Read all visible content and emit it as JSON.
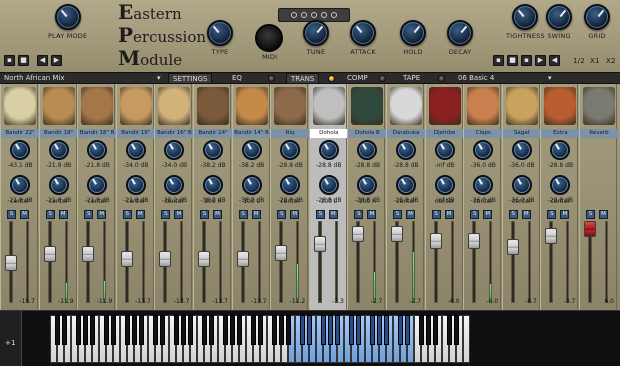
{
  "header": {
    "logo": [
      "Eastern",
      "Percussion",
      "Module"
    ],
    "knobs": {
      "play_mode": "PLAY MODE",
      "type": "TYPE",
      "midi": "MIDI",
      "tune": "TUNE",
      "attack": "ATTACK",
      "hold": "HOLD",
      "decay": "DECAY",
      "tightness": "TIGHTNESS",
      "swing": "SWING",
      "grid": "GRID"
    },
    "transport": {
      "ratio": "1/2",
      "x1": "X1",
      "x2": "X2"
    }
  },
  "toolbar": {
    "preset": "North African Mix",
    "settings": "SETTINGS",
    "eq": "EQ",
    "trans": "TRANS",
    "comp": "COMP",
    "tape": "TAPE",
    "pattern": "06 Basic 4",
    "active_led": "trans"
  },
  "channels": [
    {
      "name": "Bandir 22\"",
      "v1": "-43.1 dB",
      "v2": "-21.8 dB",
      "pan": "center",
      "vol": "-15.7",
      "fader_pos": 0.52,
      "meter": 0.0
    },
    {
      "name": "Bandir 18\"",
      "v1": "-21.8 dB",
      "v2": "-21.8 dB",
      "pan": "center",
      "vol": "-11.9",
      "fader_pos": 0.38,
      "meter": 0.24
    },
    {
      "name": "Bandir 18\" B",
      "v1": "-21.8 dB",
      "v2": "-21.8 dB",
      "pan": "center",
      "vol": "-11.9",
      "fader_pos": 0.38,
      "meter": 0.26
    },
    {
      "name": "Bandir 16\"",
      "v1": "-34.0 dB",
      "v2": "-21.8 dB",
      "pan": "center",
      "vol": "-13.7",
      "fader_pos": 0.45,
      "meter": 0.0
    },
    {
      "name": "Bandir 16\" B",
      "v1": "-34.0 dB",
      "v2": "-38.2 dB",
      "pan": "center",
      "vol": "-13.7",
      "fader_pos": 0.45,
      "meter": 0.0
    },
    {
      "name": "Bandir 14\"",
      "v1": "-38.2 dB",
      "v2": "-38.2 dB",
      "pan": "100 R",
      "vol": "-13.7",
      "fader_pos": 0.45,
      "meter": 0.0
    },
    {
      "name": "Bandir 14\" B",
      "v1": "-38.2 dB",
      "v2": "-38.2 dB",
      "pan": "100 L",
      "vol": "-13.7",
      "fader_pos": 0.45,
      "meter": 0.0
    },
    {
      "name": "Riq",
      "v1": "-28.8 dB",
      "v2": "-28.8 dB",
      "pan": "center",
      "vol": "-11.2",
      "fader_pos": 0.36,
      "meter": 0.48
    },
    {
      "name": "Dohola",
      "v1": "-28.8 dB",
      "v2": "-28.8 dB",
      "pan": "100 L",
      "vol": "-7.3",
      "fader_pos": 0.23,
      "meter": 0.0,
      "selected": true
    },
    {
      "name": "Dohola B",
      "v1": "-28.8 dB",
      "v2": "-28.8 dB",
      "pan": "100 R",
      "vol": "-2.7",
      "fader_pos": 0.08,
      "meter": 0.38
    },
    {
      "name": "Darabuka",
      "v1": "-28.8 dB",
      "v2": "-28.8 dB",
      "pan": "center",
      "vol": "-2.7",
      "fader_pos": 0.08,
      "meter": 0.62
    },
    {
      "name": "Djembe",
      "v1": "-inf dB",
      "v2": "-inf dB",
      "pan": "center",
      "vol": "-6.0",
      "fader_pos": 0.18,
      "meter": 0.0
    },
    {
      "name": "Claps",
      "v1": "-36.0 dB",
      "v2": "-36.0 dB",
      "pan": "center",
      "vol": "-6.0",
      "fader_pos": 0.18,
      "meter": 0.22
    },
    {
      "name": "Sagat",
      "v1": "-36.0 dB",
      "v2": "-36.0 dB",
      "pan": "center",
      "vol": "-8.7",
      "fader_pos": 0.28,
      "meter": 0.0
    },
    {
      "name": "Extra",
      "v1": "-28.8 dB",
      "v2": "-28.8 dB",
      "pan": "center",
      "vol": "-3.7",
      "fader_pos": 0.11,
      "meter": 0.0
    },
    {
      "name": "Reverb",
      "v1": "",
      "v2": "",
      "pan": "",
      "vol": "6.0",
      "fader_pos": 0.0,
      "meter": 0.0,
      "reverb": true
    }
  ],
  "keyboard": {
    "white_key_count": 60,
    "highlight_start": 34,
    "highlight_end": 51,
    "octave_label": "+1"
  },
  "drum_colors": [
    "#d9cfa5",
    "#b98c52",
    "#a57748",
    "#c69b62",
    "#d2b27a",
    "#7a5a3a",
    "#c48a4a",
    "#8e6a4b",
    "#bfbfbf",
    "#2f4a3d",
    "#d8d8d8",
    "#8a2020",
    "#c8804e",
    "#c9a25f",
    "#b85d2f",
    "#7a7a70"
  ]
}
